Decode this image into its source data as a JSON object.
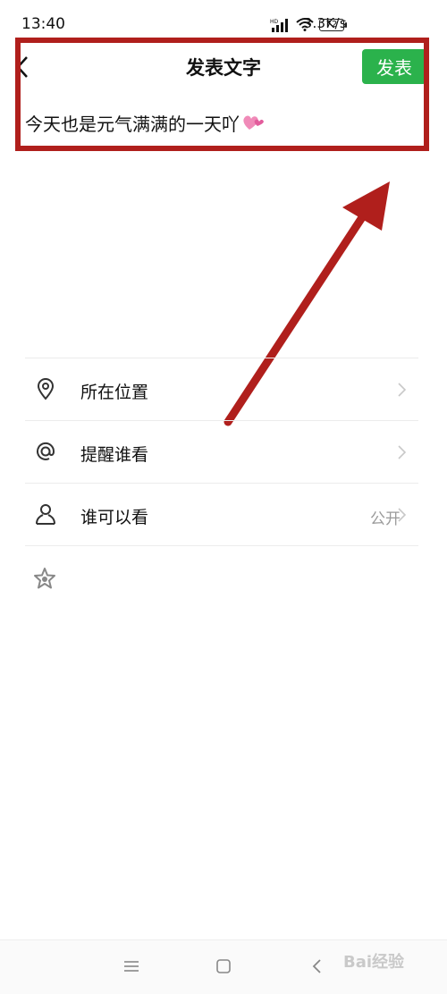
{
  "status_bar": {
    "time": "13:40",
    "network_speed": "3.3K/s",
    "battery": "72"
  },
  "header": {
    "title": "发表文字",
    "publish_label": "发表",
    "publish_color": "#2bb24c"
  },
  "post": {
    "text": "今天也是元气满满的一天吖",
    "emoji": "heart-icon"
  },
  "options": [
    {
      "icon": "location-pin-icon",
      "label": "所在位置",
      "value": ""
    },
    {
      "icon": "at-sign-icon",
      "label": "提醒谁看",
      "value": ""
    },
    {
      "icon": "person-icon",
      "label": "谁可以看",
      "value": "公开"
    }
  ],
  "annotation": {
    "color": "#b01f1c"
  },
  "nav_bar": {
    "icons": [
      "menu-icon",
      "home-square-icon",
      "back-triangle-icon"
    ],
    "watermark": "Bai经验"
  }
}
